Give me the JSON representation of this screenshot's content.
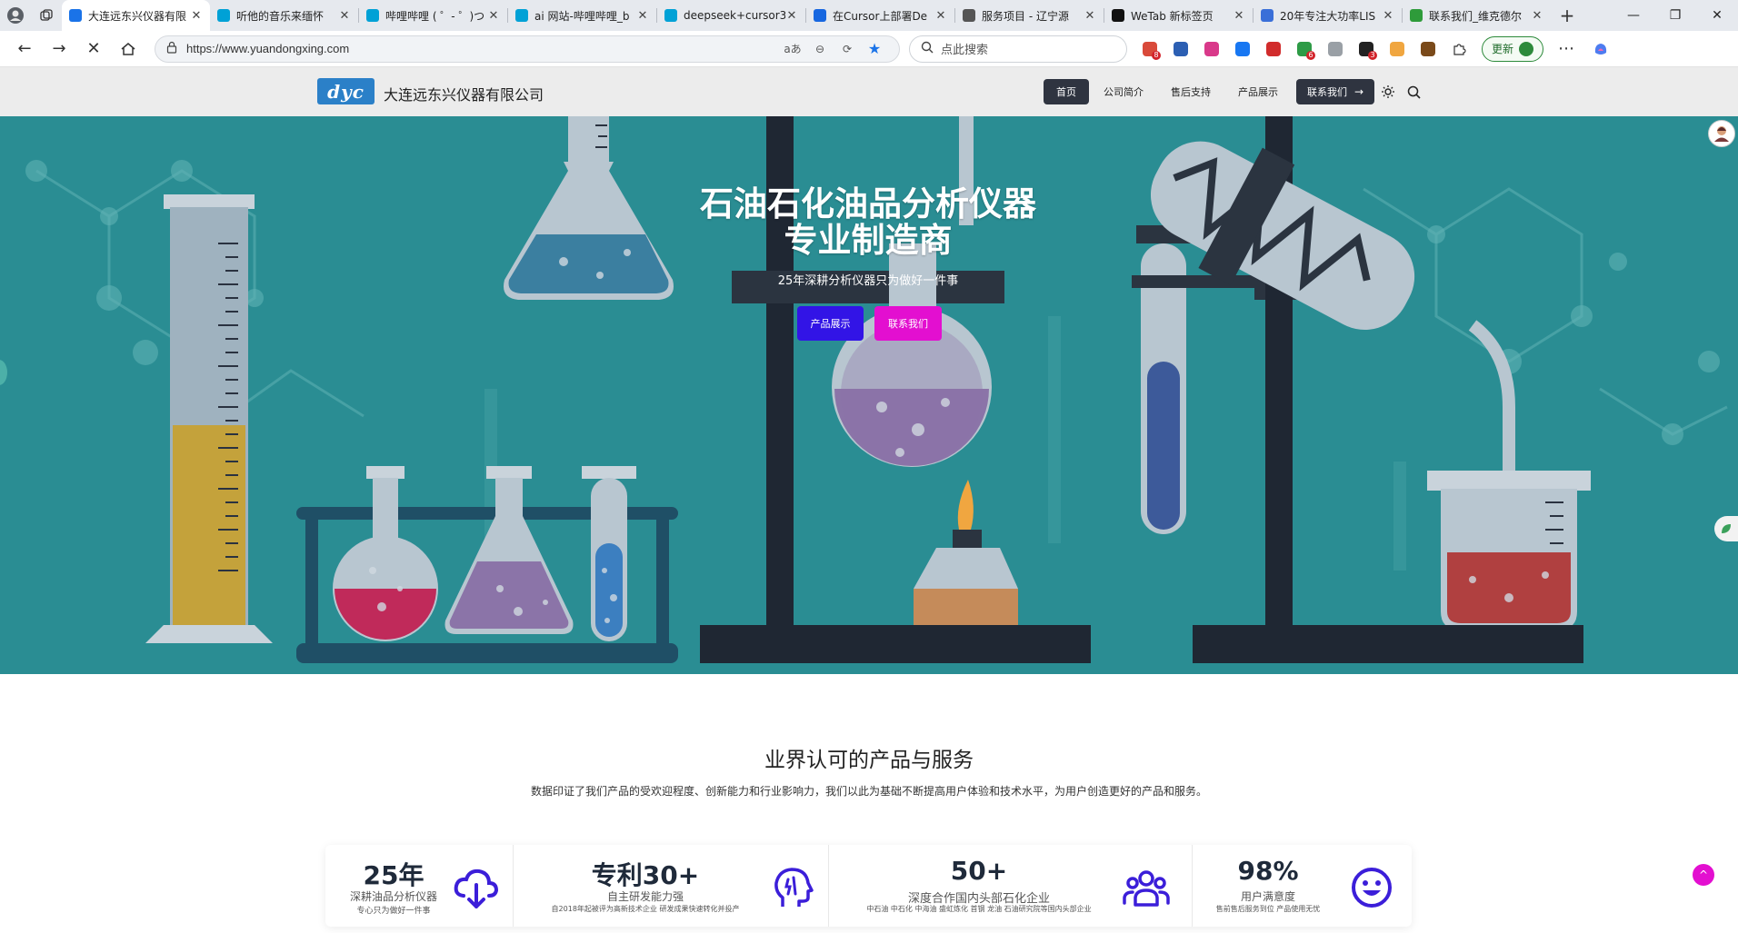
{
  "browser": {
    "tabs": [
      {
        "title": "大连远东兴仪器有限",
        "favicon": "#1a73e8",
        "active": true
      },
      {
        "title": "听他的音乐来缅怀",
        "favicon": "#00a1d6",
        "active": false
      },
      {
        "title": "哔哩哔哩 ( ゜- ゜)つ",
        "favicon": "#00a1d6",
        "active": false
      },
      {
        "title": "ai 网站-哔哩哔哩_b",
        "favicon": "#00a1d6",
        "active": false
      },
      {
        "title": "deepseek+cursor3",
        "favicon": "#00a1d6",
        "active": false
      },
      {
        "title": "在Cursor上部署De",
        "favicon": "#1767e0",
        "active": false
      },
      {
        "title": "服务项目 - 辽宁源",
        "favicon": "#555555",
        "active": false
      },
      {
        "title": "WeTab 新标签页",
        "favicon": "#111111",
        "active": false
      },
      {
        "title": "20年专注大功率LIS",
        "favicon": "#3a6fd8",
        "active": false
      },
      {
        "title": "联系我们_维克德尔",
        "favicon": "#2e9b3a",
        "active": false
      }
    ],
    "url": "https://www.yuandongxing.com",
    "search_placeholder": "点此搜索",
    "update_label": "更新",
    "extensions": [
      {
        "name": "puzzle-ext",
        "color": "#d94a3a",
        "badge": "8"
      },
      {
        "name": "reader-ext",
        "color": "#2c5fb3",
        "badge": ""
      },
      {
        "name": "translate-ext",
        "color": "#d9398a",
        "badge": ""
      },
      {
        "name": "messenger-ext",
        "color": "#1877f2",
        "badge": ""
      },
      {
        "name": "adblock-ext",
        "color": "#d12c2c",
        "badge": ""
      },
      {
        "name": "shield-ext",
        "color": "#2e9b46",
        "badge": "6"
      },
      {
        "name": "cast-ext",
        "color": "#9aa0a6",
        "badge": ""
      },
      {
        "name": "note-ext",
        "color": "#222222",
        "badge": "3"
      },
      {
        "name": "orange-ext",
        "color": "#f0a640",
        "badge": ""
      },
      {
        "name": "cookie-ext",
        "color": "#7a4a1a",
        "badge": ""
      }
    ]
  },
  "site": {
    "logo_text": "dyc",
    "company_name": "大连远东兴仪器有限公司",
    "nav": {
      "home": "首页",
      "about": "公司简介",
      "service": "售后支持",
      "products": "产品展示",
      "contact": "联系我们"
    }
  },
  "hero": {
    "title": "石油石化油品分析仪器专业制造商",
    "subtitle": "25年深耕分析仪器只为做好一件事",
    "btn_products": "产品展示",
    "btn_contact": "联系我们",
    "colors": {
      "products_button": "#3214e6",
      "contact_button": "#e30fd0",
      "background": "#2a8d93"
    }
  },
  "section": {
    "title": "业界认可的产品与服务",
    "desc": "数据印证了我们产品的受欢迎程度、创新能力和行业影响力，我们以此为基础不断提高用户体验和技术水平，为用户创造更好的产品和服务。",
    "stats": [
      {
        "big": "25年",
        "mid": "深耕油品分析仪器",
        "small": "专心只为做好一件事",
        "icon": "cloud-download-icon"
      },
      {
        "big": "专利30+",
        "mid": "自主研发能力强",
        "small": "自2018年起被评为高新技术企业 研发成果快速转化并投产",
        "icon": "head-idea-icon"
      },
      {
        "big": "50+",
        "mid": "深度合作国内头部石化企业",
        "small": "中石油 中石化 中海油 盛虹炼化 首钢 龙油 石油研究院等国内头部企业",
        "icon": "users-icon"
      },
      {
        "big": "98%",
        "mid": "用户满意度",
        "small": "售前售后服务到位 产品使用无忧",
        "icon": "smile-icon"
      }
    ]
  }
}
